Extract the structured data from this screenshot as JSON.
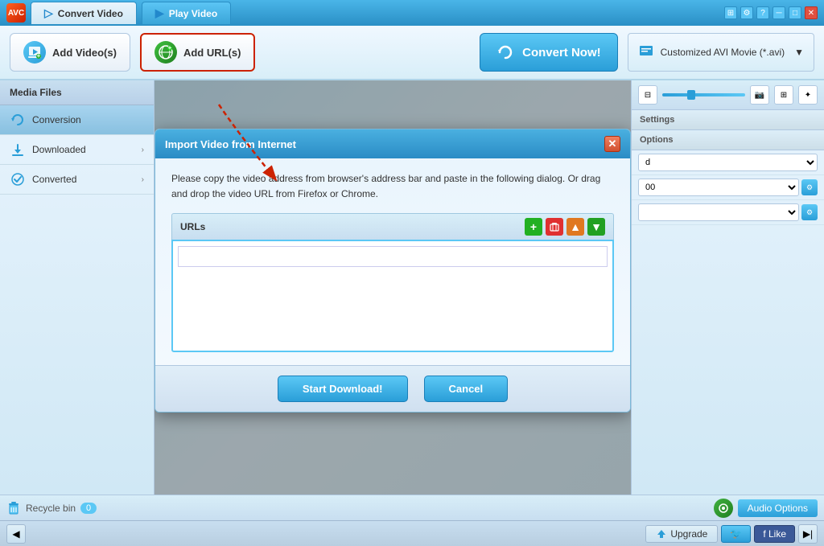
{
  "titlebar": {
    "app_name": "AVC",
    "tabs": [
      {
        "label": "Convert Video",
        "active": true
      },
      {
        "label": "Play Video",
        "active": false
      }
    ],
    "controls": [
      "minimize",
      "restore",
      "close"
    ]
  },
  "toolbar": {
    "add_videos_label": "Add Video(s)",
    "add_urls_label": "Add URL(s)",
    "convert_now_label": "Convert Now!",
    "format_label": "Customized AVI Movie (*.avi)"
  },
  "sidebar": {
    "header": "Media Files",
    "items": [
      {
        "id": "conversion",
        "label": "Conversion",
        "active": true,
        "has_arrow": false
      },
      {
        "id": "downloaded",
        "label": "Downloaded",
        "active": false,
        "has_arrow": true
      },
      {
        "id": "converted",
        "label": "Converted",
        "active": false,
        "has_arrow": true
      }
    ]
  },
  "right_panel": {
    "settings_label": "Settings",
    "options_label": "Options",
    "rows": [
      {
        "label": "Standard",
        "has_settings": false
      },
      {
        "label": "00",
        "has_settings": true
      },
      {
        "label": "",
        "has_settings": true
      }
    ]
  },
  "status_bar": {
    "recycle_label": "Recycle bin",
    "recycle_count": "0",
    "audio_options_label": "Audio Options"
  },
  "nav_bar": {
    "upgrade_label": "Upgrade",
    "twitter_label": "🐦",
    "facebook_label": "f Like",
    "forward_label": "▶|"
  },
  "modal": {
    "title": "Import Video from Internet",
    "description": "Please copy the video address from browser's address bar and paste in the following dialog. Or drag and drop the video URL from Firefox or Chrome.",
    "urls_label": "URLs",
    "url_input_placeholder": "",
    "start_download_label": "Start Download!",
    "cancel_label": "Cancel",
    "actions": {
      "add": "+",
      "delete": "🗑",
      "up": "▲",
      "down": "▼"
    }
  }
}
